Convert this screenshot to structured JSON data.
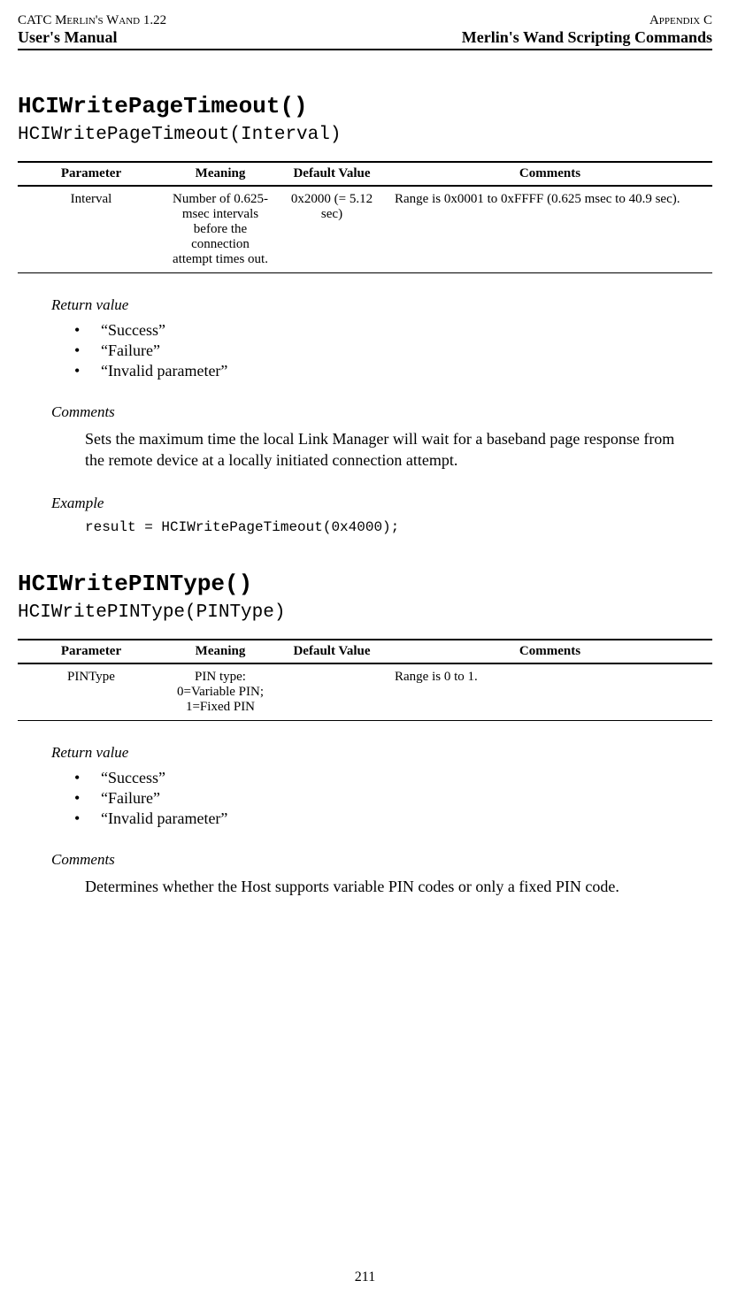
{
  "header": {
    "top_left": "CATC Merlin's Wand 1.22",
    "top_right": "Appendix C",
    "bottom_left": "User's Manual",
    "bottom_right": "Merlin's Wand Scripting Commands"
  },
  "sections": [
    {
      "title": "HCIWritePageTimeout()",
      "signature": "HCIWritePageTimeout(Interval)",
      "table": {
        "headers": [
          "Parameter",
          "Meaning",
          "Default Value",
          "Comments"
        ],
        "rows": [
          {
            "parameter": "Interval",
            "meaning": "Number of 0.625-msec intervals before the connection attempt times out.",
            "default": "0x2000 (= 5.12 sec)",
            "comments": "Range is 0x0001 to 0xFFFF (0.625 msec to 40.9 sec)."
          }
        ]
      },
      "return_label": "Return value",
      "return_values": [
        "“Success”",
        "“Failure”",
        "“Invalid parameter”"
      ],
      "comments_label": "Comments",
      "comments_text": "Sets the maximum time the local Link Manager will wait for a baseband page response from the remote device at a locally initiated connection attempt.",
      "example_label": "Example",
      "example_code": "result = HCIWritePageTimeout(0x4000);"
    },
    {
      "title": "HCIWritePINType()",
      "signature": "HCIWritePINType(PINType)",
      "table": {
        "headers": [
          "Parameter",
          "Meaning",
          "Default Value",
          "Comments"
        ],
        "rows": [
          {
            "parameter": "PINType",
            "meaning": "PIN type: 0=Variable PIN; 1=Fixed PIN",
            "default": "",
            "comments": "Range is 0 to 1."
          }
        ]
      },
      "return_label": "Return value",
      "return_values": [
        "“Success”",
        "“Failure”",
        "“Invalid parameter”"
      ],
      "comments_label": "Comments",
      "comments_text": "Determines whether the Host supports variable PIN codes or only a fixed PIN code."
    }
  ],
  "page_number": "211"
}
